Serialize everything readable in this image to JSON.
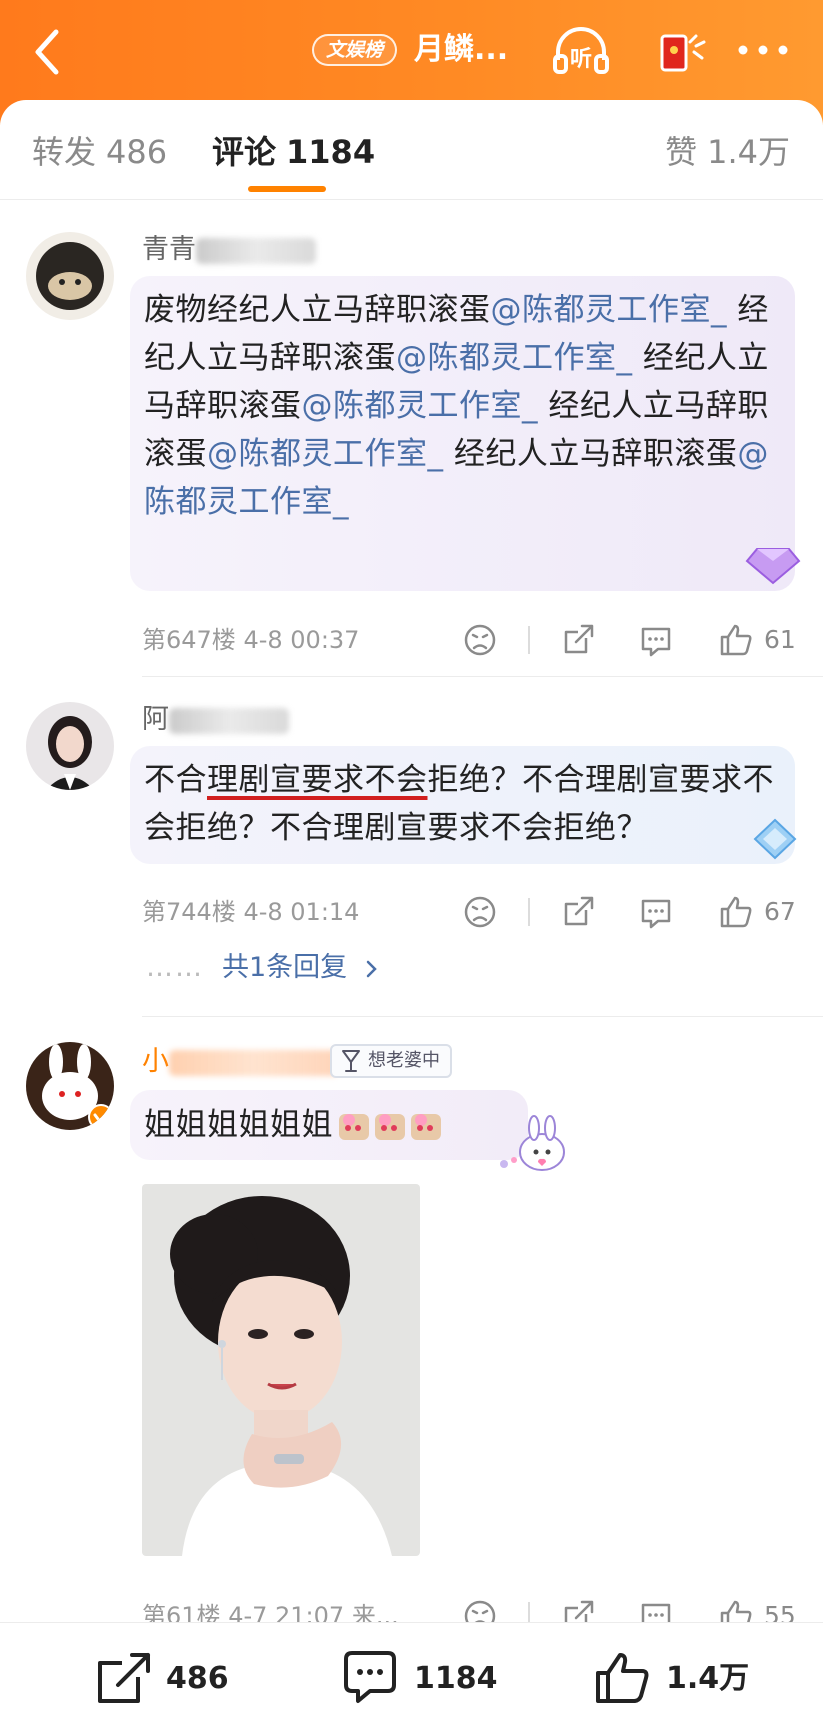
{
  "header": {
    "hot_badge": "文娱榜",
    "title": "月鳞..."
  },
  "tabs": [
    {
      "label": "转发",
      "count": "486"
    },
    {
      "label": "评论",
      "count": "1184"
    },
    {
      "label": "赞",
      "count": "1.4万"
    }
  ],
  "comments": [
    {
      "username": "青青",
      "segments": [
        "废物经纪人立马辞职滚蛋",
        "@陈都灵工作室_",
        " 经纪人立马辞职滚蛋",
        "@陈都灵工作室_",
        " 经纪人立马辞职滚蛋",
        "@陈都灵工作室_",
        " 经纪人立马辞职滚蛋",
        "@陈都灵工作室_",
        " 经纪人立马辞职滚蛋",
        "@陈都灵工作室_"
      ],
      "floor": "第647楼",
      "time": "4-8 00:37",
      "likes": "61"
    },
    {
      "username": "阿",
      "text_pre": "不合",
      "text_underlined": "理剧宣要求不会",
      "text_post": "拒绝？不合理剧宣要求不会拒绝？不合理剧宣要求不会拒绝？",
      "floor": "第744楼",
      "time": "4-8 01:14",
      "likes": "67",
      "reply_link": "共1条回复"
    },
    {
      "username": "小",
      "badge": "想老婆中",
      "text": "姐姐姐姐姐姐",
      "floor": "第61楼",
      "time": "4-7 21:07",
      "source": "来...",
      "likes": "55"
    }
  ],
  "bottom_bar": {
    "repost_count": "486",
    "comment_count": "1184",
    "like_count": "1.4万"
  },
  "colors": {
    "header_orange": "#ff8a24",
    "accent": "#ff8200",
    "mention": "#4a6fa8",
    "underline_red": "#d11f1f"
  }
}
